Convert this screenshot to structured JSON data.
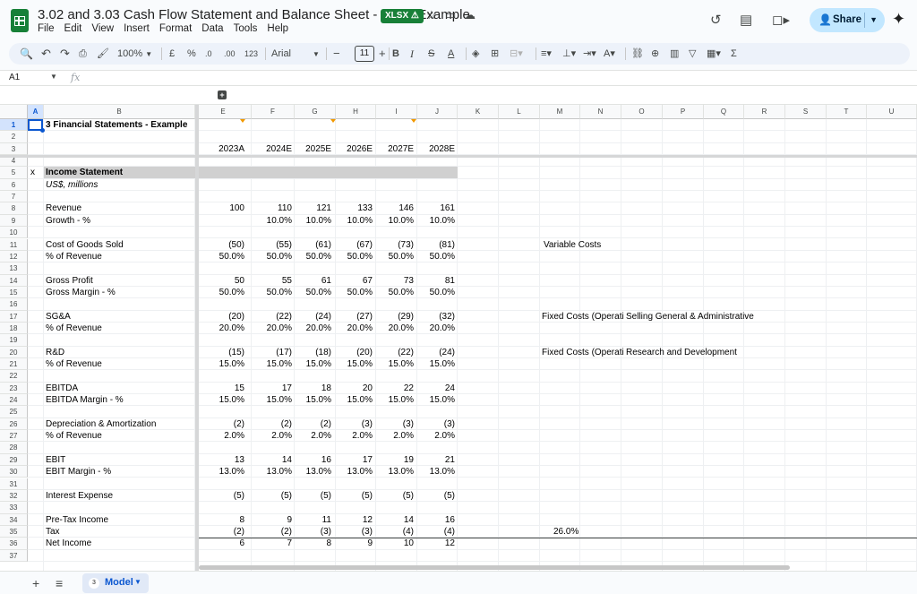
{
  "header": {
    "title": "3.02 and 3.03 Cash Flow Statement and Balance Sheet - Excel Example",
    "badge": "XLSX",
    "badge_icon": "warning-icon",
    "menu": [
      "File",
      "Edit",
      "View",
      "Insert",
      "Format",
      "Data",
      "Tools",
      "Help"
    ],
    "share_label": "Share"
  },
  "toolbar": {
    "zoom": "100%",
    "currency": "£",
    "percent": "%",
    "dec_decrease": ".0",
    "dec_increase": ".00",
    "number_format": "123",
    "font": "Arial",
    "font_size": "11"
  },
  "formula_bar": {
    "name_box": "A1",
    "fx": "fx",
    "value": ""
  },
  "group_button": "+",
  "columns": [
    "A",
    "B",
    "E",
    "F",
    "G",
    "H",
    "I",
    "J",
    "K",
    "L",
    "M",
    "N",
    "O",
    "P",
    "Q",
    "R",
    "S",
    "T",
    "U"
  ],
  "rows": [
    {
      "n": "1",
      "a": "",
      "label": "3 Financial Statements - Example",
      "style": "title",
      "values": [],
      "notes": []
    },
    {
      "n": "2",
      "a": "",
      "label": "",
      "style": "",
      "values": [],
      "notes": []
    },
    {
      "n": "3",
      "a": "",
      "label": "",
      "style": "years",
      "values": [
        "2023A",
        "2024E",
        "2025E",
        "2026E",
        "2027E",
        "2028E"
      ],
      "notes": []
    },
    {
      "n": "4",
      "a": "",
      "label": "",
      "style": "",
      "values": [],
      "notes": []
    },
    {
      "n": "5",
      "a": "x",
      "label": "Income Statement",
      "style": "section",
      "values": [],
      "notes": []
    },
    {
      "n": "6",
      "a": "",
      "label": "US$, millions",
      "style": "italic",
      "values": [],
      "notes": []
    },
    {
      "n": "7",
      "a": "",
      "label": "",
      "style": "",
      "values": [],
      "notes": []
    },
    {
      "n": "8",
      "a": "",
      "label": "Revenue",
      "style": "",
      "values": [
        "100",
        "110",
        "121",
        "133",
        "146",
        "161"
      ],
      "notes": []
    },
    {
      "n": "9",
      "a": "",
      "label": "Growth - %",
      "style": "",
      "values": [
        "",
        "10.0%",
        "10.0%",
        "10.0%",
        "10.0%",
        "10.0%"
      ],
      "notes": []
    },
    {
      "n": "10",
      "a": "",
      "label": "",
      "style": "",
      "values": [],
      "notes": []
    },
    {
      "n": "11",
      "a": "",
      "label": "Cost of Goods Sold",
      "style": "",
      "values": [
        "(50)",
        "(55)",
        "(61)",
        "(67)",
        "(73)",
        "(81)"
      ],
      "notes": [
        "Variable Costs"
      ]
    },
    {
      "n": "12",
      "a": "",
      "label": "% of Revenue",
      "style": "",
      "values": [
        "50.0%",
        "50.0%",
        "50.0%",
        "50.0%",
        "50.0%",
        "50.0%"
      ],
      "notes": []
    },
    {
      "n": "13",
      "a": "",
      "label": "",
      "style": "",
      "values": [],
      "notes": []
    },
    {
      "n": "14",
      "a": "",
      "label": "Gross Profit",
      "style": "",
      "values": [
        "50",
        "55",
        "61",
        "67",
        "73",
        "81"
      ],
      "notes": []
    },
    {
      "n": "15",
      "a": "",
      "label": "Gross Margin - %",
      "style": "",
      "values": [
        "50.0%",
        "50.0%",
        "50.0%",
        "50.0%",
        "50.0%",
        "50.0%"
      ],
      "notes": []
    },
    {
      "n": "16",
      "a": "",
      "label": "",
      "style": "",
      "values": [],
      "notes": []
    },
    {
      "n": "17",
      "a": "",
      "label": "SG&A",
      "style": "",
      "values": [
        "(20)",
        "(22)",
        "(24)",
        "(27)",
        "(29)",
        "(32)"
      ],
      "notes": [
        "Fixed Costs (Operati",
        "Selling General & Administrative"
      ]
    },
    {
      "n": "18",
      "a": "",
      "label": "% of Revenue",
      "style": "",
      "values": [
        "20.0%",
        "20.0%",
        "20.0%",
        "20.0%",
        "20.0%",
        "20.0%"
      ],
      "notes": []
    },
    {
      "n": "19",
      "a": "",
      "label": "",
      "style": "",
      "values": [],
      "notes": []
    },
    {
      "n": "20",
      "a": "",
      "label": "R&D",
      "style": "",
      "values": [
        "(15)",
        "(17)",
        "(18)",
        "(20)",
        "(22)",
        "(24)"
      ],
      "notes": [
        "Fixed Costs (Operati",
        "Research and Development"
      ]
    },
    {
      "n": "21",
      "a": "",
      "label": "% of Revenue",
      "style": "",
      "values": [
        "15.0%",
        "15.0%",
        "15.0%",
        "15.0%",
        "15.0%",
        "15.0%"
      ],
      "notes": []
    },
    {
      "n": "22",
      "a": "",
      "label": "",
      "style": "",
      "values": [],
      "notes": []
    },
    {
      "n": "23",
      "a": "",
      "label": "EBITDA",
      "style": "",
      "values": [
        "15",
        "17",
        "18",
        "20",
        "22",
        "24"
      ],
      "notes": []
    },
    {
      "n": "24",
      "a": "",
      "label": "EBITDA Margin - %",
      "style": "",
      "values": [
        "15.0%",
        "15.0%",
        "15.0%",
        "15.0%",
        "15.0%",
        "15.0%"
      ],
      "notes": []
    },
    {
      "n": "25",
      "a": "",
      "label": "",
      "style": "",
      "values": [],
      "notes": []
    },
    {
      "n": "26",
      "a": "",
      "label": "Depreciation & Amortization",
      "style": "",
      "values": [
        "(2)",
        "(2)",
        "(2)",
        "(3)",
        "(3)",
        "(3)"
      ],
      "notes": []
    },
    {
      "n": "27",
      "a": "",
      "label": "% of Revenue",
      "style": "",
      "values": [
        "2.0%",
        "2.0%",
        "2.0%",
        "2.0%",
        "2.0%",
        "2.0%"
      ],
      "notes": []
    },
    {
      "n": "28",
      "a": "",
      "label": "",
      "style": "",
      "values": [],
      "notes": []
    },
    {
      "n": "29",
      "a": "",
      "label": "EBIT",
      "style": "",
      "values": [
        "13",
        "14",
        "16",
        "17",
        "19",
        "21"
      ],
      "notes": []
    },
    {
      "n": "30",
      "a": "",
      "label": "EBIT Margin - %",
      "style": "",
      "values": [
        "13.0%",
        "13.0%",
        "13.0%",
        "13.0%",
        "13.0%",
        "13.0%"
      ],
      "notes": []
    },
    {
      "n": "31",
      "a": "",
      "label": "",
      "style": "",
      "values": [],
      "notes": []
    },
    {
      "n": "32",
      "a": "",
      "label": "Interest Expense",
      "style": "",
      "values": [
        "(5)",
        "(5)",
        "(5)",
        "(5)",
        "(5)",
        "(5)"
      ],
      "notes": []
    },
    {
      "n": "33",
      "a": "",
      "label": "",
      "style": "",
      "values": [],
      "notes": []
    },
    {
      "n": "34",
      "a": "",
      "label": "Pre-Tax Income",
      "style": "",
      "values": [
        "8",
        "9",
        "11",
        "12",
        "14",
        "16"
      ],
      "notes": []
    },
    {
      "n": "35",
      "a": "",
      "label": "Tax",
      "style": "",
      "values": [
        "(2)",
        "(2)",
        "(3)",
        "(3)",
        "(4)",
        "(4)"
      ],
      "notes": [
        "26.0%"
      ]
    },
    {
      "n": "36",
      "a": "",
      "label": "Net Income",
      "style": "",
      "values": [
        "6",
        "7",
        "8",
        "9",
        "10",
        "12"
      ],
      "notes": []
    },
    {
      "n": "37",
      "a": "",
      "label": "",
      "style": "",
      "values": [],
      "notes": []
    }
  ],
  "tabs": {
    "add_icon": "plus-icon",
    "list_icon": "menu-icon",
    "active_badge": "3",
    "active_label": "Model"
  },
  "colors": {
    "brand_green": "#188038",
    "accent_blue": "#0b57d0",
    "share_bg": "#c2e7ff",
    "section_band": "#d0d0d0",
    "note_marker": "#f29900"
  }
}
